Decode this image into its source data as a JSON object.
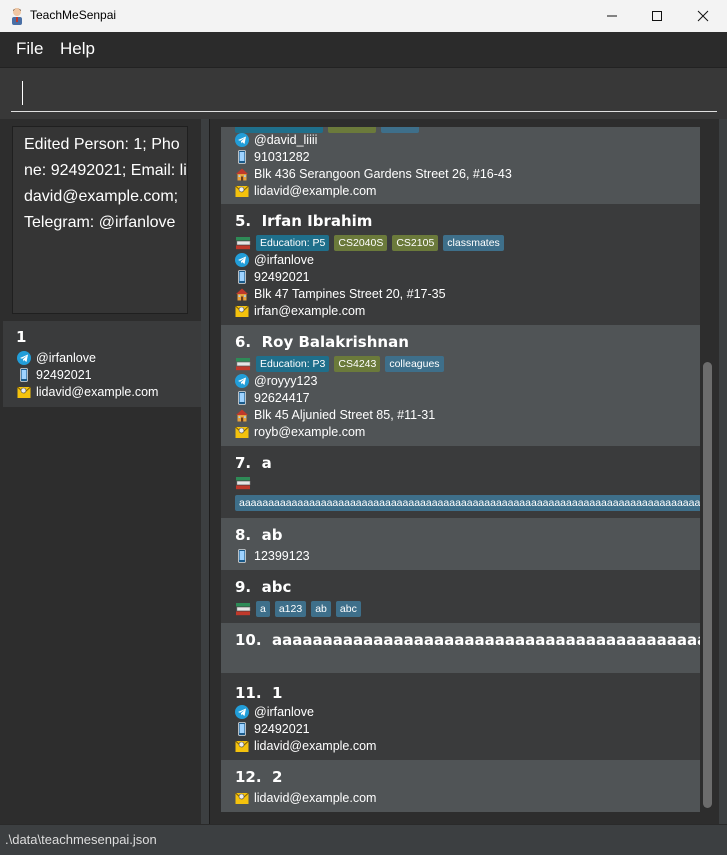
{
  "window": {
    "title": "TeachMeSenpai"
  },
  "menu": {
    "file": "File",
    "help": "Help"
  },
  "command": {
    "value": ""
  },
  "result": {
    "text": "Edited Person: 1; Phone: 92492021; Email: lidavid@example.com; Telegram: @irfanlove"
  },
  "left_card": {
    "name": "1",
    "telegram": "@irfanlove",
    "phone": "92492021",
    "email": "lidavid@example.com"
  },
  "persons": {
    "p4": {
      "telegram": "@david_liiii",
      "phone": "91031282",
      "address": "Blk 436 Serangoon Gardens Street 26, #16-43",
      "email": "lidavid@example.com"
    },
    "p5": {
      "index": "5.",
      "name": "Irfan Ibrahim",
      "tags": [
        "Education: P5",
        "CS2040S",
        "CS2105",
        "classmates"
      ],
      "telegram": "@irfanlove",
      "phone": "92492021",
      "address": "Blk 47 Tampines Street 20, #17-35",
      "email": "irfan@example.com"
    },
    "p6": {
      "index": "6.",
      "name": "Roy Balakrishnan",
      "tags": [
        "Education: P3",
        "CS4243",
        "colleagues"
      ],
      "telegram": "@royyy123",
      "phone": "92624417",
      "address": "Blk 45 Aljunied Street 85, #11-31",
      "email": "royb@example.com"
    },
    "p7": {
      "index": "7.",
      "name": "a",
      "tag": "aaaaaaaaaaaaaaaaaaaaaaaaaaaaaaaaaaaaaaaaaaaaaaaaaaaaaaaaaaaaaaaaaaaaaaaaaaaaaaaaaaaa"
    },
    "p8": {
      "index": "8.",
      "name": "ab",
      "phone": "12399123"
    },
    "p9": {
      "index": "9.",
      "name": "abc",
      "tags": [
        "a",
        "a123",
        "ab",
        "abc"
      ]
    },
    "p10": {
      "index": "10.",
      "name": "aaaaaaaaaaaaaaaaaaaaaaaaaaaaaaaaaaaaaaaaaaaaaaaaaa..."
    },
    "p11": {
      "index": "11.",
      "name": "1",
      "telegram": "@irfanlove",
      "phone": "92492021",
      "email": "lidavid@example.com"
    },
    "p12": {
      "index": "12.",
      "name": "2",
      "email": "lidavid@example.com"
    }
  },
  "status": {
    "path": ".\\data\\teachmesenpai.json"
  },
  "colors": {
    "card_light": "#505456",
    "card_dark": "#3a3b3c",
    "tag_education": "#1f6f8b",
    "tag_module": "#6b7a3b",
    "tag_other": "#3e6f8a",
    "telegram_blue": "#229ed9"
  },
  "icons": [
    "telegram-icon",
    "phone-icon",
    "address-icon",
    "email-icon",
    "education-icon"
  ]
}
